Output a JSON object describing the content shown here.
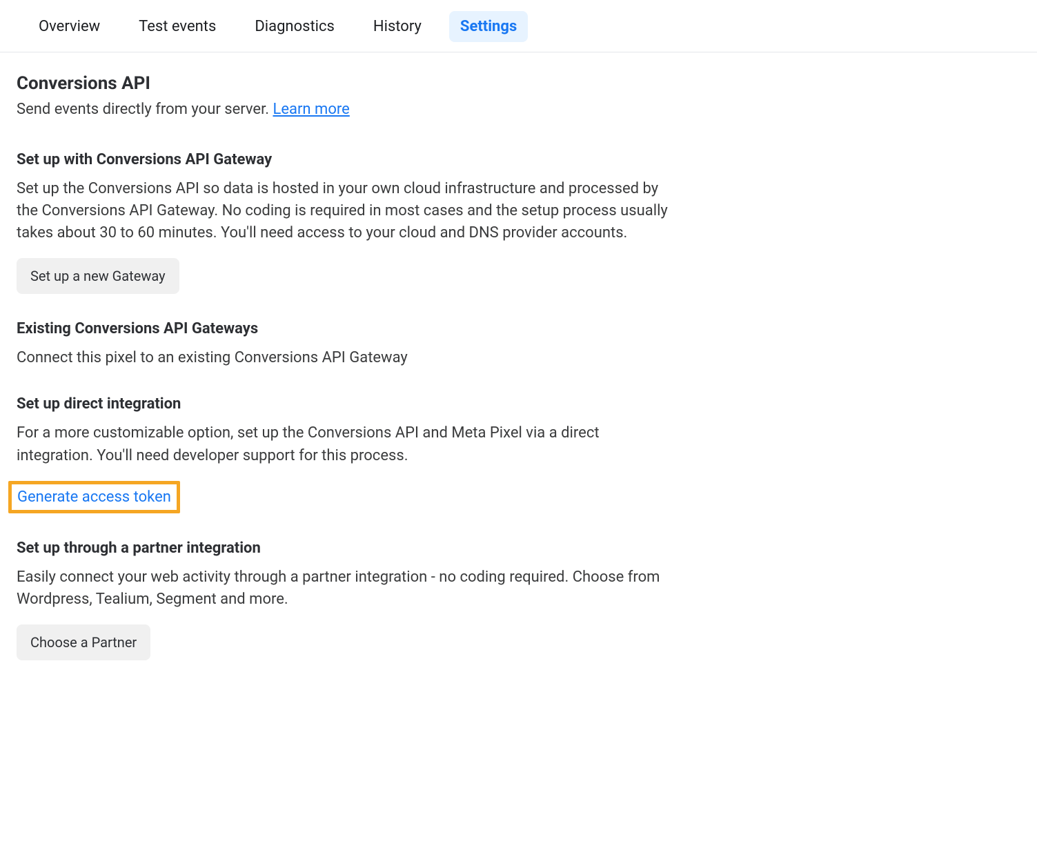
{
  "tabs": [
    {
      "label": "Overview",
      "active": false
    },
    {
      "label": "Test events",
      "active": false
    },
    {
      "label": "Diagnostics",
      "active": false
    },
    {
      "label": "History",
      "active": false
    },
    {
      "label": "Settings",
      "active": true
    }
  ],
  "header": {
    "title": "Conversions API",
    "subtitle_prefix": "Send events directly from your server. ",
    "learn_more_label": "Learn more"
  },
  "sections": {
    "gateway": {
      "heading": "Set up with Conversions API Gateway",
      "body": "Set up the Conversions API so data is hosted in your own cloud infrastructure and processed by the Conversions API Gateway. No coding is required in most cases and the setup process usually takes about 30 to 60 minutes. You'll need access to your cloud and DNS provider accounts.",
      "button_label": "Set up a new Gateway"
    },
    "existing": {
      "heading": "Existing Conversions API Gateways",
      "body": "Connect this pixel to an existing Conversions API Gateway"
    },
    "direct": {
      "heading": "Set up direct integration",
      "body": "For a more customizable option, set up the Conversions API and Meta Pixel via a direct integration. You'll need developer support for this process.",
      "link_label": "Generate access token"
    },
    "partner": {
      "heading": "Set up through a partner integration",
      "body": "Easily connect your web activity through a partner integration - no coding required. Choose from Wordpress, Tealium, Segment and more.",
      "button_label": "Choose a Partner"
    }
  }
}
